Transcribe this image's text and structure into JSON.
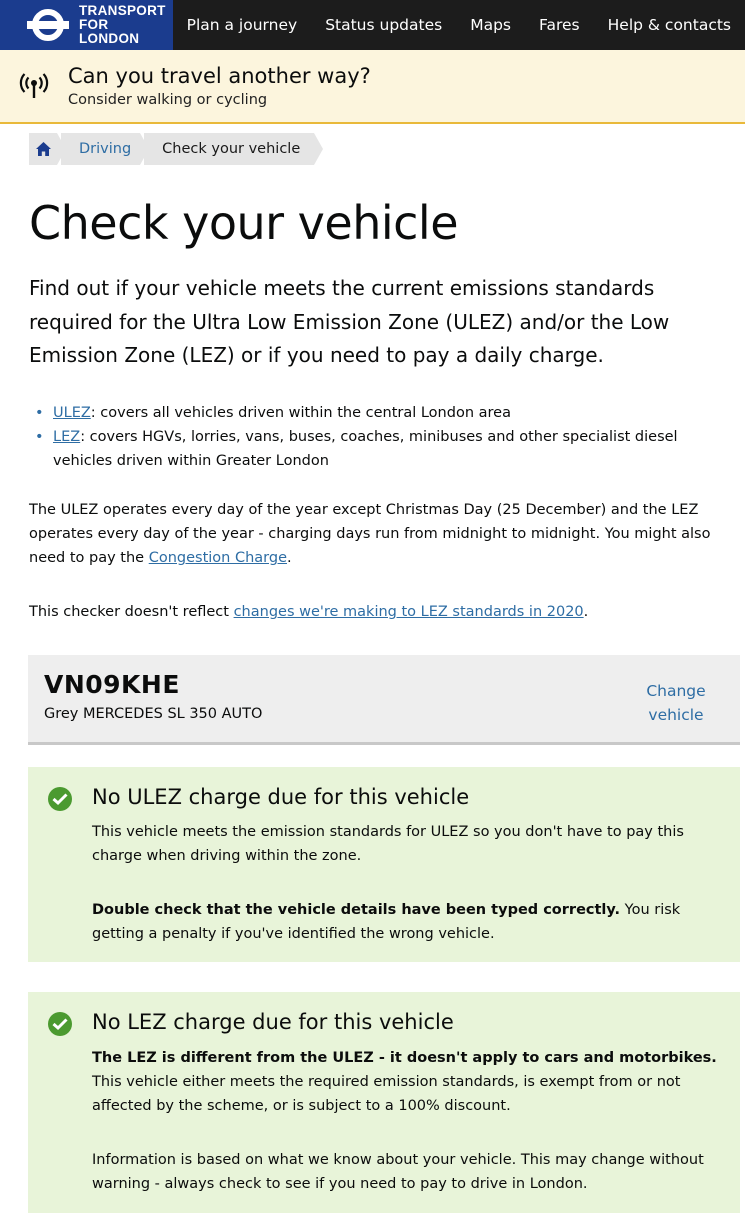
{
  "header": {
    "brand_line1": "TRANSPORT",
    "brand_line2": "FOR LONDON",
    "nav": [
      "Plan a journey",
      "Status updates",
      "Maps",
      "Fares",
      "Help & contacts"
    ],
    "brand_color": "#1b3c8e",
    "bar_color": "#1c1c1c"
  },
  "alert": {
    "icon": "broadcast-icon",
    "title": "Can you travel another way?",
    "subtitle": "Consider walking or cycling",
    "bg_color": "#fcf5dd",
    "border_color": "#e9b93a"
  },
  "breadcrumb": {
    "home_icon": "home-icon",
    "items": [
      "Driving",
      "Check your vehicle"
    ]
  },
  "page": {
    "title": "Check your vehicle",
    "lead": "Find out if your vehicle meets the current emissions standards required for the Ultra Low Emission Zone (ULEZ) and/or the Low Emission Zone (LEZ) or if you need to pay a daily charge.",
    "bullets": [
      {
        "link": "ULEZ",
        "text": ": covers all vehicles driven within the central London area"
      },
      {
        "link": "LEZ",
        "text": ": covers HGVs, lorries, vans, buses, coaches, minibuses and other specialist diesel vehicles driven within Greater London"
      }
    ],
    "para1_text": "The ULEZ operates every day of the year except Christmas Day (25 December) and the LEZ operates every day of the year - charging days run from midnight to midnight. You might also need to pay the ",
    "para1_link": "Congestion Charge",
    "para1_end": ".",
    "para2_text": "This checker doesn't reflect ",
    "para2_link": "changes we're making to LEZ standards in 2020",
    "para2_end": ".",
    "link_color": "#2e6da4"
  },
  "vehicle": {
    "registration": "VN09KHE",
    "description": "Grey MERCEDES SL 350 AUTO",
    "change_label": "Change vehicle"
  },
  "results": [
    {
      "icon": "check-circle-icon",
      "title": "No ULEZ charge due for this vehicle",
      "p1": "This vehicle meets the emission standards for ULEZ so you don't have to pay this charge when driving within the zone.",
      "p2_bold": "Double check that the vehicle details have been typed correctly.",
      "p2_rest": " You risk getting a penalty if you've identified the wrong vehicle."
    },
    {
      "icon": "check-circle-icon",
      "title": "No LEZ charge due for this vehicle",
      "p1_bold": "The LEZ is different from the ULEZ - it doesn't apply to cars and motorbikes.",
      "p1_rest": " This vehicle either meets the required emission standards, is exempt from or not affected by the scheme, or is subject to a 100% discount.",
      "p2": "Information is based on what we know about your vehicle. This may change without warning - always check to see if you need to pay to drive in London."
    }
  ],
  "colors": {
    "success_bg": "#e8f4d9",
    "success_icon": "#4b9a30",
    "vehicle_bg": "#eeeeee"
  }
}
